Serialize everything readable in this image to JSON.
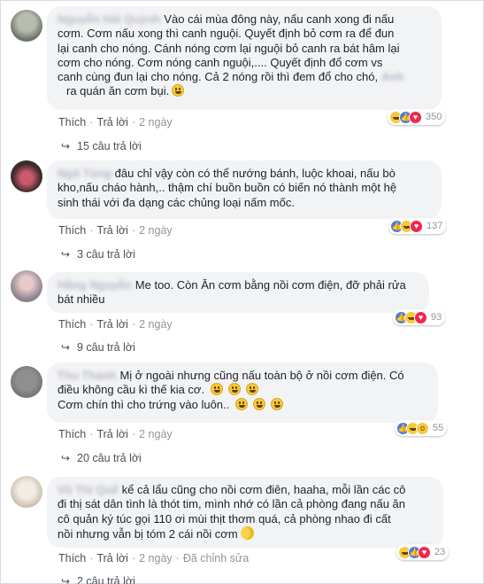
{
  "comments": [
    {
      "text_lines": [
        "Vào cái mùa đông này, nấu canh xong đi nấu",
        "cơm. Cơm nấu xong thì canh nguội. Quyết định bỏ cơm ra để đun",
        "lại canh cho nóng. Cánh nóng cơm lại nguội bỏ canh ra bát hâm lại",
        "cơm cho nóng. Cơm nóng canh nguội,.... Quyết định đổ cơm vs",
        "canh cùng đun lại cho nóng. Cả 2 nóng rồi thì đem đổ cho chó,",
        "ra quán ăn cơm bụi."
      ],
      "actions": {
        "like": "Thích",
        "reply": "Trả lời",
        "time": "2 ngày"
      },
      "reaction_count": "350",
      "replies_label": "15 câu trả lời",
      "reactions": [
        "haha",
        "like",
        "love"
      ]
    },
    {
      "text_lines": [
        "đâu chỉ vậy còn có thể nướng bánh, luộc khoai, nấu bò",
        "kho,nấu cháo hành,.. thậm chí buồn buồn có biến nó thành một hệ",
        "sinh thái với đa dạng các chủng loại nấm mốc."
      ],
      "actions": {
        "like": "Thích",
        "reply": "Trả lời",
        "time": "2 ngày"
      },
      "reaction_count": "137",
      "replies_label": "3 câu trả lời",
      "reactions": [
        "like",
        "haha",
        "love"
      ]
    },
    {
      "text_lines": [
        "Me too. Còn Ăn cơm bằng nồi cơm điện, đỡ phải rửa",
        "bát nhiều"
      ],
      "actions": {
        "like": "Thích",
        "reply": "Trả lời",
        "time": "2 ngày"
      },
      "reaction_count": "93",
      "replies_label": "9 câu trả lời",
      "reactions": [
        "like",
        "haha",
        "love"
      ]
    },
    {
      "text_lines": [
        "Mị ở ngoài nhưng cũng nấu toàn bộ ở nồi cơm điện. Có",
        "điều không cầu kì thế kia cơ.",
        "Cơm chín thì cho trứng vào luôn.."
      ],
      "actions": {
        "like": "Thích",
        "reply": "Trả lời",
        "time": "2 ngày"
      },
      "reaction_count": "55",
      "replies_label": "20 câu trả lời",
      "reactions": [
        "like",
        "haha",
        "wow"
      ]
    },
    {
      "text_lines": [
        "kể cả lẩu cũng cho nồi cơm điên, haaha, mỗi lần các cô",
        "đi thị sát dân tình là thót tim, mình nhớ có lần cả phòng đang nấu ăn",
        "cô quản ký túc gọi 110 ơi mùi thịt thơm quá, cả phòng nhao đi cất",
        "nồi nhưng vẫn bị tóm 2 cái nồi cơm"
      ],
      "actions": {
        "like": "Thích",
        "reply": "Trả lời",
        "time": "2 ngày",
        "edited": "Đã chỉnh sửa"
      },
      "reaction_count": "23",
      "replies_label": "2 câu trả lời",
      "reactions": [
        "haha",
        "like",
        "love"
      ]
    }
  ],
  "colors": {
    "bubble": "#f2f3f5",
    "link": "#4b4f56",
    "meta": "#90949c",
    "like": "#4a7de2",
    "love": "#f0284a",
    "haha": "#f7c83b"
  }
}
